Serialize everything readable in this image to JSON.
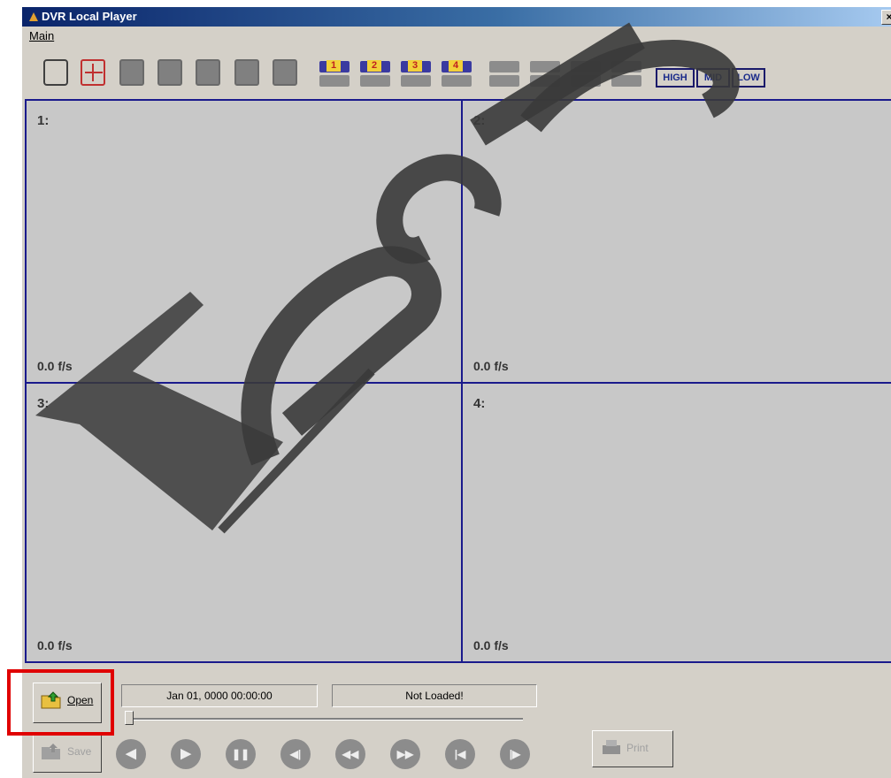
{
  "window": {
    "title": "DVR Local Player",
    "close_glyph": "×"
  },
  "menu": {
    "items": [
      "Main"
    ]
  },
  "toolbar": {
    "camera_labels": [
      "1",
      "2",
      "3",
      "4"
    ],
    "quality": {
      "high": "HIGH",
      "mid": "MID",
      "low": "LOW"
    }
  },
  "views": [
    {
      "label": "1:",
      "fps": "0.0 f/s"
    },
    {
      "label": "2:",
      "fps": "0.0 f/s"
    },
    {
      "label": "3:",
      "fps": "0.0 f/s"
    },
    {
      "label": "4:",
      "fps": "0.0 f/s"
    }
  ],
  "controls": {
    "open_label": "Open",
    "save_label": "Save",
    "print_label": "Print",
    "datetime": "Jan 01, 0000  00:00:00",
    "status": "Not Loaded!",
    "playback": [
      {
        "name": "prev-icon",
        "glyph": "◀"
      },
      {
        "name": "play-icon",
        "glyph": "▶"
      },
      {
        "name": "pause-icon",
        "glyph": "❚❚"
      },
      {
        "name": "reverse-step-icon",
        "glyph": "◀|"
      },
      {
        "name": "rewind-icon",
        "glyph": "◀◀"
      },
      {
        "name": "fast-forward-icon",
        "glyph": "▶▶"
      },
      {
        "name": "step-back-icon",
        "glyph": "|◀"
      },
      {
        "name": "step-forward-icon",
        "glyph": "|▶"
      }
    ]
  },
  "colors": {
    "titlebar": "#0a246a",
    "grid_border": "#1a1a8c",
    "highlight": "#e00000",
    "watermark": "#3a3a3a"
  },
  "watermark": {
    "text": "Tech"
  }
}
